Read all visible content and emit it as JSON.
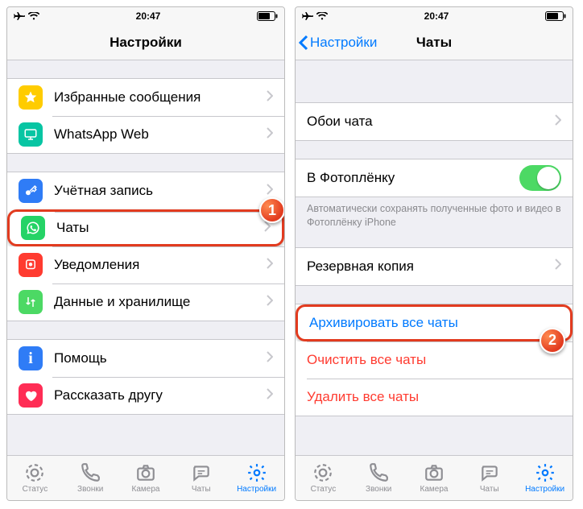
{
  "statusbar": {
    "time": "20:47"
  },
  "left": {
    "title": "Настройки",
    "groups": [
      [
        {
          "icon": "star",
          "color": "#ffcc00",
          "label": "Избранные сообщения",
          "chevron": true
        },
        {
          "icon": "monitor",
          "color": "#07c5a3",
          "label": "WhatsApp Web",
          "chevron": true
        }
      ],
      [
        {
          "icon": "key",
          "color": "#2f7cf6",
          "label": "Учётная запись",
          "chevron": true
        },
        {
          "icon": "whatsapp",
          "color": "#25d366",
          "label": "Чаты",
          "chevron": true,
          "highlight": true
        },
        {
          "icon": "bell",
          "color": "#ff3b30",
          "label": "Уведомления",
          "chevron": true
        },
        {
          "icon": "arrows",
          "color": "#4cd964",
          "label": "Данные и хранилище",
          "chevron": true
        }
      ],
      [
        {
          "icon": "info",
          "color": "#2f7cf6",
          "label": "Помощь",
          "chevron": true
        },
        {
          "icon": "heart",
          "color": "#ff2d55",
          "label": "Рассказать другу",
          "chevron": true
        }
      ]
    ]
  },
  "right": {
    "back": "Настройки",
    "title": "Чаты",
    "sections": {
      "wallpaper": {
        "label": "Обои чата"
      },
      "cameraRoll": {
        "label": "В Фотоплёнку",
        "note": "Автоматически сохранять полученные фото и видео в Фотоплёнку iPhone"
      },
      "backup": {
        "label": "Резервная копия"
      },
      "archive": {
        "label": "Архивировать все чаты"
      },
      "clear": {
        "label": "Очистить все чаты"
      },
      "delete": {
        "label": "Удалить все чаты"
      }
    }
  },
  "tabs": [
    {
      "key": "status",
      "label": "Статус"
    },
    {
      "key": "calls",
      "label": "Звонки"
    },
    {
      "key": "camera",
      "label": "Камера"
    },
    {
      "key": "chats",
      "label": "Чаты"
    },
    {
      "key": "settings",
      "label": "Настройки",
      "active": true
    }
  ],
  "badges": {
    "one": "1",
    "two": "2"
  }
}
